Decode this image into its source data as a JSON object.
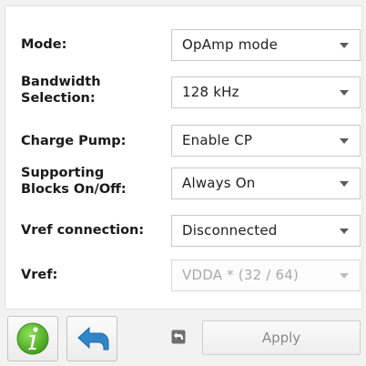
{
  "rows": [
    {
      "label": "Mode:",
      "value": "OpAmp mode"
    },
    {
      "label_line1": "Bandwidth",
      "label_line2": "Selection:",
      "value": "128 kHz"
    },
    {
      "label": "Charge Pump:",
      "value": "Enable CP"
    },
    {
      "label_line1": "Supporting",
      "label_line2": "Blocks On/Off:",
      "value": "Always On"
    },
    {
      "label": "Vref connection:",
      "value": "Disconnected"
    },
    {
      "label": "Vref:",
      "value": "VDDA * (32 / 64)",
      "disabled": true
    }
  ],
  "toolbar": {
    "info_icon": "info-icon",
    "undo_icon": "undo-icon",
    "apply_label": "Apply"
  },
  "colors": {
    "info_green": "#5cb82f",
    "undo_blue": "#2f86c9"
  }
}
